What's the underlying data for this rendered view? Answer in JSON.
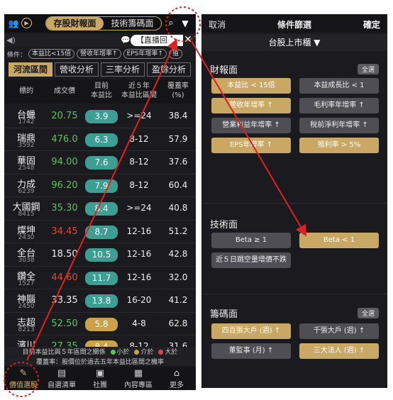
{
  "left": {
    "top_tabs": [
      "存股財報面",
      "技術籌碼面"
    ],
    "news_text": "【直播回",
    "conditions_label": "條件：",
    "conditions": [
      "本益比<15倍",
      "營收年增率↑",
      "EPS年增率↑",
      "殖"
    ],
    "sub_tabs": [
      "河流區間",
      "營收分析",
      "三率分析",
      "盈餘分析"
    ],
    "headers": {
      "name": "標的",
      "price": "成交價",
      "pe_now_l1": "目前",
      "pe_now_l2": "本益比",
      "range_l1": "近５年",
      "range_l2": "本益比區間",
      "cov_l1": "覆蓋率",
      "cov_l2": "(%)"
    },
    "rows": [
      {
        "name": "台蠟",
        "code": "1742",
        "price": "20.75",
        "price_color": "#5cc35c",
        "pe": "3.9",
        "pe_color": "#3d9e93",
        "range": ">=24",
        "cov": "38.4"
      },
      {
        "name": "瑞鼎",
        "code": "3592",
        "price": "476.0",
        "price_color": "#5cc35c",
        "pe": "6.3",
        "pe_color": "#3d9e93",
        "range": "8-12",
        "cov": "57.9"
      },
      {
        "name": "華固",
        "code": "2548",
        "price": "94.00",
        "price_color": "#5cc35c",
        "pe": "7.6",
        "pe_color": "#3d9e93",
        "range": "8-12",
        "cov": "37.6"
      },
      {
        "name": "力成",
        "code": "6239",
        "price": "96.20",
        "price_color": "#5cc35c",
        "pe": "7.9",
        "pe_color": "#3d9e93",
        "range": "8-12",
        "cov": "60.4"
      },
      {
        "name": "大國鋼",
        "code": "8415",
        "price": "35.30",
        "price_color": "#5cc35c",
        "pe": "8.4",
        "pe_color": "#3d9e93",
        "range": ">=24",
        "cov": "40.8"
      },
      {
        "name": "燦坤",
        "code": "2430",
        "price": "34.45",
        "price_color": "#e0483c",
        "pe": "8.7",
        "pe_color": "#3d9e93",
        "range": "12-16",
        "cov": "51.2"
      },
      {
        "name": "全台",
        "code": "3038",
        "price": "18.50",
        "price_color": "#f0f0f0",
        "pe": "10.5",
        "pe_color": "#3d9e93",
        "range": "12-16",
        "cov": "42.8"
      },
      {
        "name": "鑽全",
        "code": "1527",
        "price": "44.60",
        "price_color": "#e0483c",
        "pe": "11.7",
        "pe_color": "#3d9e93",
        "range": "12-16",
        "cov": "32.0"
      },
      {
        "name": "神腦",
        "code": "2450",
        "price": "33.35",
        "price_color": "#f0f0f0",
        "pe": "13.8",
        "pe_color": "#3d9e93",
        "range": "16-20",
        "cov": "41.2"
      },
      {
        "name": "志超",
        "code": "8213",
        "price": "52.50",
        "price_color": "#5cc35c",
        "pe": "5.8",
        "pe_color": "#c9a24a",
        "range": "4-8",
        "cov": "62.8"
      },
      {
        "name": "濱川",
        "code": "",
        "price": "27.35",
        "price_color": "#5cc35c",
        "pe": "8.4",
        "pe_color": "#c9a24a",
        "range": "8-12",
        "cov": "31.6"
      }
    ],
    "legend1_text": "目前本益比與５年區間之關係",
    "legend_small": "小於",
    "legend_mid": "介於",
    "legend_big": "大於",
    "legend2_text": "覆蓋率：股價位於過去五年本益比區間之機率",
    "nav": [
      {
        "label": "價值選股",
        "icon": "✎"
      },
      {
        "label": "自選清單",
        "icon": "▤"
      },
      {
        "label": "社團",
        "icon": "▣"
      },
      {
        "label": "內容專區",
        "icon": "▦"
      },
      {
        "label": "更多",
        "icon": "⌂"
      }
    ]
  },
  "right": {
    "cancel": "取消",
    "title": "條件篩選",
    "confirm": "確定",
    "market": "台股上市櫃 ▼",
    "select_all": "全選",
    "fin_title": "財報面",
    "fin_buttons": [
      "本益比 < 15倍",
      "本益成長比 < 1",
      "營收年增率 ↑",
      "毛利率年增率 ↑",
      "營業利益年增率 ↑",
      "稅前淨利年增率 ↑",
      "EPS年增率 ↑",
      "殖利率 > 5%"
    ],
    "tech_title": "技術面",
    "tech_buttons": [
      "Beta ≥ 1",
      "Beta < 1",
      "近５日跳空量增價不跌"
    ],
    "chip_title": "籌碼面",
    "chip_buttons": [
      "四百張大戶 (週) ↑",
      "千張大戶 (週) ↑",
      "董監事 (月) ↑",
      "三大法人 (週) ↑"
    ]
  },
  "colors": {
    "gold": "#c9a764",
    "green": "#5cc35c",
    "red": "#e0483c",
    "teal": "#3d9e93",
    "annotation": "#e02020"
  }
}
